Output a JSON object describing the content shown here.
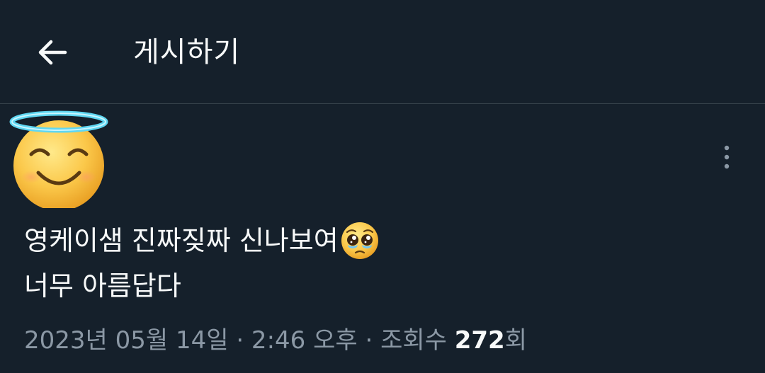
{
  "header": {
    "title": "게시하기",
    "back_icon": "arrow-left-icon"
  },
  "post": {
    "avatar_icon": "smiling-face-with-halo-emoji",
    "more_icon": "vertical-ellipsis-icon",
    "lines": [
      "영케이샘 진짜짖짜 신나보여",
      "너무 아름답다"
    ],
    "inline_emoji": "pleading-face-emoji",
    "meta": {
      "timestamp": "2023년 05월 14일 · 2:46 오후 · 조회수 ",
      "view_count": "272",
      "view_unit": "회"
    }
  },
  "colors": {
    "background": "#15202b",
    "text_primary": "#f7f9f9",
    "text_secondary": "#8b98a5",
    "divider": "#38444d"
  }
}
